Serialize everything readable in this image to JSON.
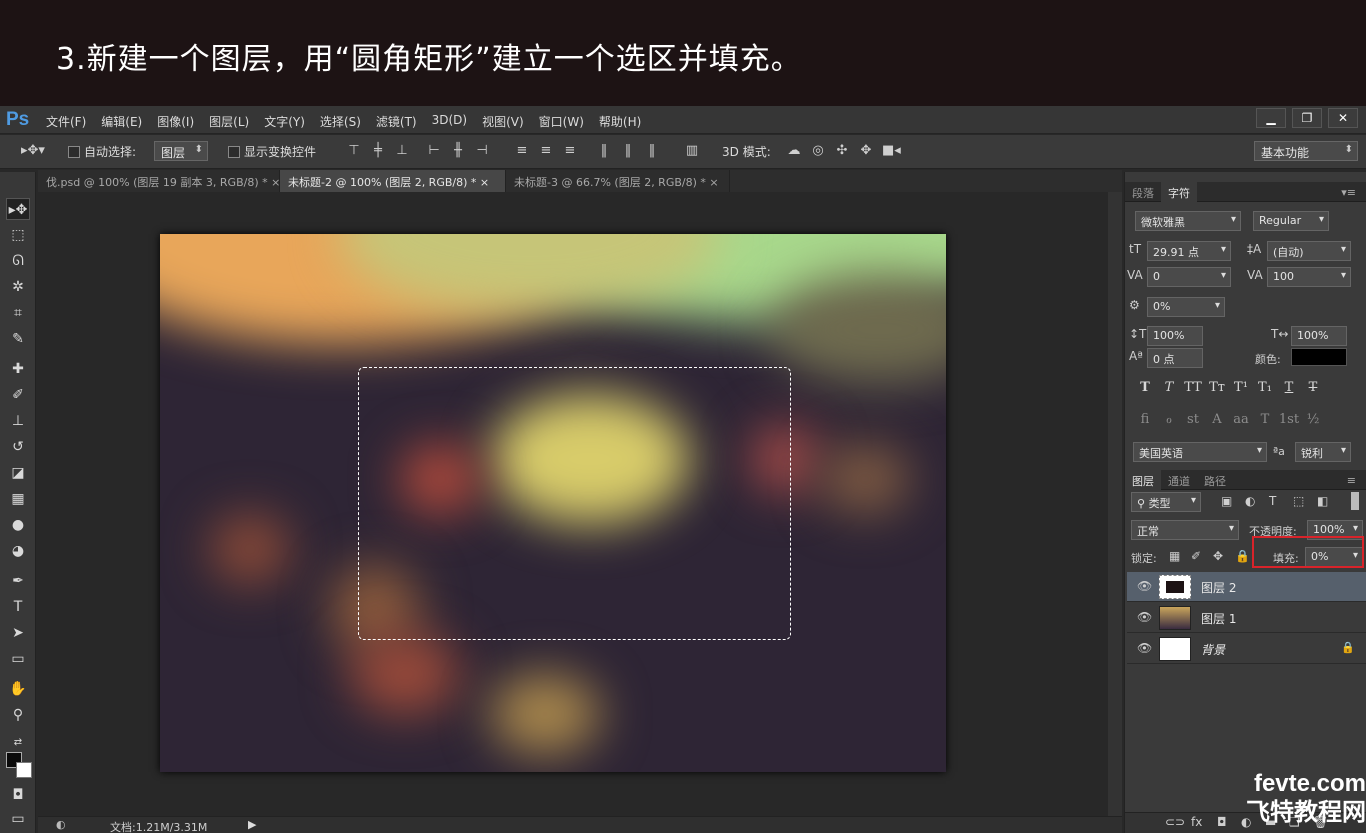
{
  "header": {
    "caption": "3.新建一个图层，用“圆角矩形”建立一个选区并填充。"
  },
  "app": {
    "logo": "Ps"
  },
  "menu": [
    "文件(F)",
    "编辑(E)",
    "图像(I)",
    "图层(L)",
    "文字(Y)",
    "选择(S)",
    "滤镜(T)",
    "3D(D)",
    "视图(V)",
    "窗口(W)",
    "帮助(H)"
  ],
  "options": {
    "auto_select_label": "自动选择:",
    "auto_select_value": "图层",
    "show_transform_label": "显示变换控件",
    "mode_3d_label": "3D 模式:",
    "workspace": "基本功能"
  },
  "tabs": [
    {
      "label": "伐.psd @ 100% (图层 19 副本 3, RGB/8) *",
      "close": "×"
    },
    {
      "label": "未标题-2 @ 100% (图层 2, RGB/8) *",
      "close": "×"
    },
    {
      "label": "未标题-3 @ 66.7% (图层 2, RGB/8) *",
      "close": "×"
    }
  ],
  "status": {
    "doc": "文档:1.21M/3.31M"
  },
  "char_panel": {
    "tabs": [
      "段落",
      "字符"
    ],
    "font": "微软雅黑",
    "style": "Regular",
    "size": "29.91 点",
    "leading": "(自动)",
    "kerning": "0",
    "tracking": "100",
    "tsume": "0%",
    "vscale": "100%",
    "hscale": "100%",
    "baseline": "0 点",
    "color_label": "颜色:",
    "language": "美国英语",
    "aa_label": "ªa",
    "antialias": "锐利",
    "glyphs1": [
      "T",
      "T",
      "TT",
      "Tт",
      "T¹",
      "T₁",
      "T",
      "T"
    ],
    "glyphs2": [
      "fi",
      "ℴ",
      "st",
      "A",
      "aa",
      "T",
      "1st",
      "½"
    ]
  },
  "layers_panel": {
    "tabs": [
      "图层",
      "通道",
      "路径"
    ],
    "filter": "类型",
    "blend": "正常",
    "opacity_label": "不透明度:",
    "opacity": "100%",
    "lock_label": "锁定:",
    "fill_label": "填充:",
    "fill": "0%",
    "layers": [
      {
        "name": "图层 2",
        "selected": true
      },
      {
        "name": "图层 1",
        "selected": false
      },
      {
        "name": "背景",
        "selected": false,
        "locked": true
      }
    ]
  },
  "watermark": {
    "line1": "fevte.com",
    "line2": "飞特教程网"
  },
  "colors": {
    "accent": "#4f9be2",
    "highlight": "#d9232a",
    "selected_layer": "#56606c"
  }
}
